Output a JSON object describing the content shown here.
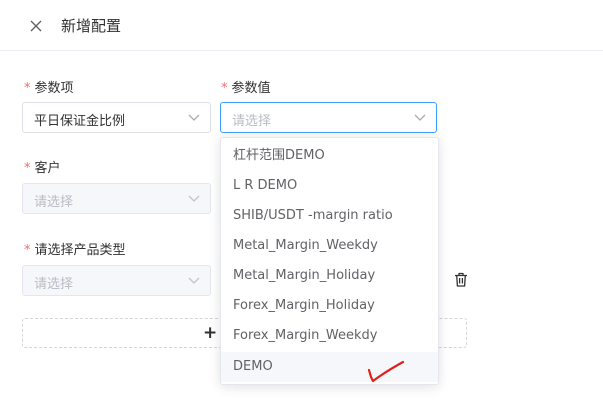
{
  "dialog": {
    "title": "新增配置"
  },
  "fields": {
    "param_item": {
      "label": "参数项",
      "value": "平日保证金比例"
    },
    "param_value": {
      "label": "参数值",
      "placeholder": "请选择"
    },
    "customer": {
      "label": "客户",
      "placeholder": "请选择"
    },
    "product_type": {
      "label": "请选择产品类型",
      "placeholder": "请选择"
    }
  },
  "required_mark": "*",
  "dropdown": {
    "options": [
      "杠杆范围DEMO",
      "L R DEMO",
      "SHIB/USDT -margin ratio",
      "Metal_Margin_Weekdy",
      "Metal_Margin_Holiday",
      "Forex_Margin_Holiday",
      "Forex_Margin_Weekdy",
      "DEMO"
    ],
    "hovered_option": "DEMO"
  },
  "add_row": {
    "label": "+"
  },
  "colors": {
    "accent": "#409eff",
    "required": "#f56c6c",
    "annotation": "#e0201d"
  },
  "icons": {
    "close": "close-icon",
    "chevron": "chevron-down-icon",
    "trash": "trash-icon"
  }
}
